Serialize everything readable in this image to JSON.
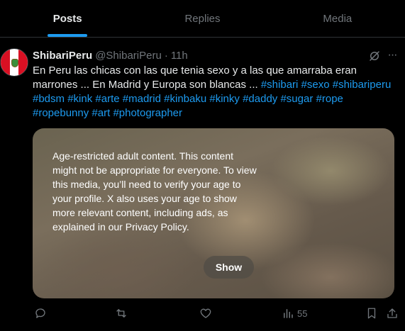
{
  "tabs": [
    {
      "label": "Posts",
      "active": true
    },
    {
      "label": "Replies",
      "active": false
    },
    {
      "label": "Media",
      "active": false
    }
  ],
  "post": {
    "display_name": "ShibariPeru",
    "handle": "@ShibariPeru",
    "separator": "·",
    "time": "11h",
    "text_plain": "En Peru las chicas con las que tenia sexo y a las que amarraba eran marrones ... En Madrid y Europa son blancas ... ",
    "hashtags": [
      "#shibari",
      "#sexo",
      "#shibariperu",
      "#bdsm",
      "#kink",
      "#arte",
      "#madrid",
      "#kinbaku",
      "#kinky",
      "#daddy",
      "#sugar",
      "#rope",
      "#ropebunny",
      "#art",
      "#photographer"
    ],
    "media_warning": "Age-restricted adult content. This content might not be appropriate for everyone. To view this media, you’ll need to verify your age to your profile. X also uses your age to show more relevant content, including ads, as explained in our Privacy Policy.",
    "show_label": "Show",
    "views_count": "55"
  },
  "icons": {
    "grok": "grok-icon",
    "more": "more-icon",
    "reply": "reply-icon",
    "repost": "repost-icon",
    "like": "like-icon",
    "views": "views-icon",
    "bookmark": "bookmark-icon",
    "share": "share-icon"
  },
  "colors": {
    "background": "#000000",
    "accent": "#1d9bf0",
    "text": "#e7e9ea",
    "muted": "#71767b"
  }
}
